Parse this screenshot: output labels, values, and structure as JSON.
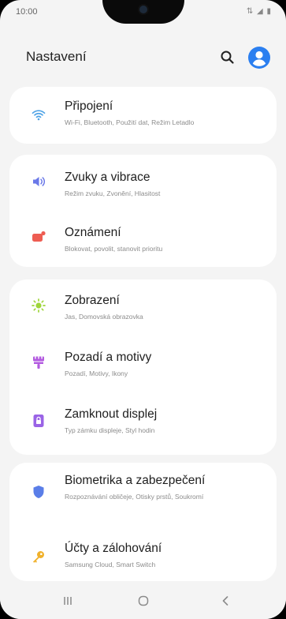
{
  "status_bar": {
    "time": "10:00",
    "icons": "⇅ ◢ ▮"
  },
  "header": {
    "title": "Nastavení",
    "search_icon": "search-icon",
    "account_icon": "account-icon"
  },
  "colors": {
    "accent": "#2b7ff0",
    "wifi": "#4fa3e6",
    "sound": "#6a78e8",
    "notifications": "#ee5d52",
    "display": "#9fd53a",
    "wallpaper": "#b35be0",
    "lock": "#9a63e6",
    "biometrics": "#5a7ee8",
    "accounts": "#f0b12b"
  },
  "groups": [
    {
      "items": [
        {
          "title": "Připojení",
          "subtitle": "Wi-Fi, Bluetooth, Použití dat, Režim Letadlo",
          "icon": "wifi-icon"
        }
      ]
    },
    {
      "items": [
        {
          "title": "Zvuky a vibrace",
          "subtitle": "Režim zvuku, Zvonění, Hlasitost",
          "icon": "speaker-icon"
        },
        {
          "title": "Oznámení",
          "subtitle": "Blokovat, povolit, stanovit prioritu",
          "icon": "notification-icon"
        }
      ]
    },
    {
      "items": [
        {
          "title": "Zobrazení",
          "subtitle": "Jas, Domovská obrazovka",
          "icon": "brightness-icon"
        },
        {
          "title": "Pozadí a motivy",
          "subtitle": "Pozadí, Motivy, Ikony",
          "icon": "paintbrush-icon"
        },
        {
          "title": "Zamknout displej",
          "subtitle": "Typ zámku displeje, Styl hodin",
          "icon": "lock-screen-icon"
        }
      ]
    },
    {
      "items": [
        {
          "title": "Biometrika a zabezpečení",
          "subtitle": "Rozpoznávání obličeje, Otisky prstů, Soukromí",
          "icon": "shield-icon"
        },
        {
          "title": "Účty a zálohování",
          "subtitle": "Samsung Cloud, Smart Switch",
          "icon": "key-icon"
        }
      ]
    }
  ],
  "navbar": {
    "recents_icon": "recents-icon",
    "home_icon": "home-icon",
    "back_icon": "back-icon"
  }
}
